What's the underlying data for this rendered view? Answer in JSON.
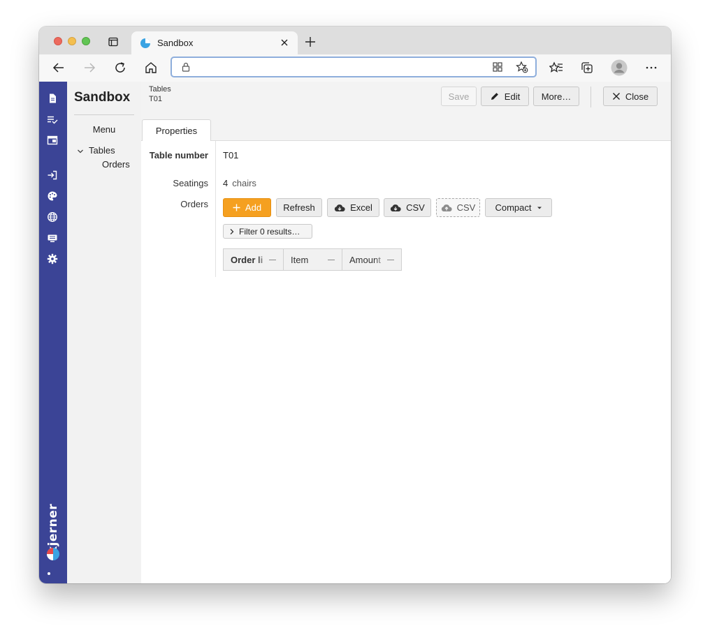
{
  "browser": {
    "tab_title": "Sandbox",
    "address_value": ""
  },
  "app": {
    "brand": "kjerner",
    "colors": {
      "rail": "#3b4496",
      "add_button": "#f5a020",
      "tab_favicon": "#3aa3e3"
    }
  },
  "nav": {
    "title": "Sandbox",
    "menu_label": "Menu",
    "tables_label": "Tables",
    "orders_label": "Orders"
  },
  "header": {
    "breadcrumb_parent": "Tables",
    "breadcrumb_current": "T01",
    "save_label": "Save",
    "edit_label": "Edit",
    "more_label": "More…",
    "close_label": "Close"
  },
  "tabs": [
    {
      "label": "Properties"
    }
  ],
  "form": {
    "table_number_label": "Table number",
    "table_number_value": "T01",
    "seatings_label": "Seatings",
    "seatings_value": "4",
    "seatings_unit": "chairs",
    "orders_label": "Orders"
  },
  "orders_toolbar": {
    "add_label": "Add",
    "refresh_label": "Refresh",
    "excel_label": "Excel",
    "csv_label": "CSV",
    "csv_upload_label": "CSV",
    "compact_label": "Compact",
    "filter_label": "Filter 0 results…"
  },
  "grid": {
    "columns": [
      {
        "label": "Order li"
      },
      {
        "label": "Item"
      },
      {
        "label": "Amount"
      }
    ]
  }
}
